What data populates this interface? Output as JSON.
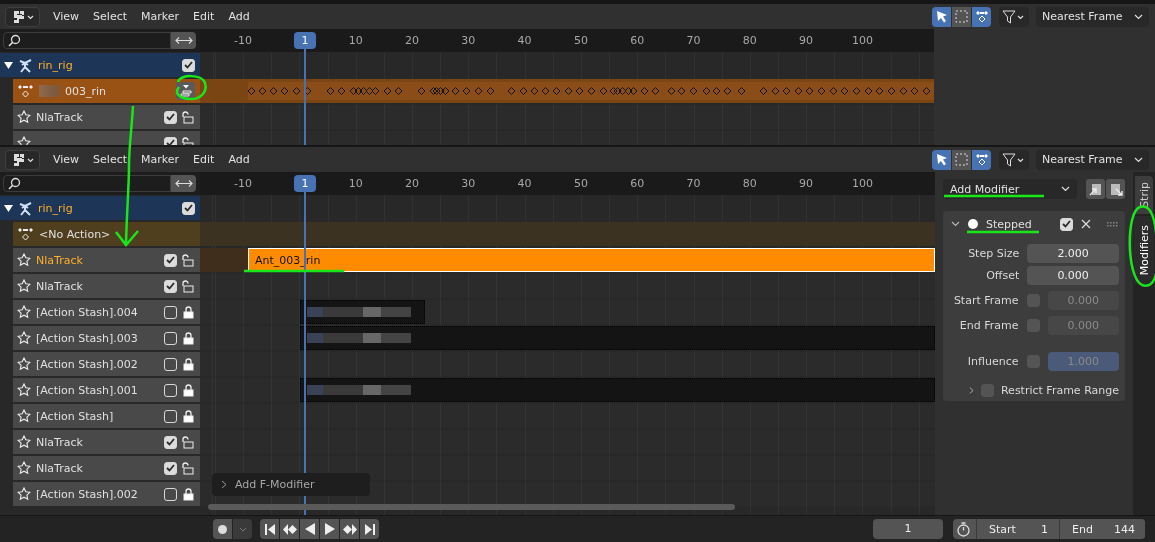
{
  "editors": [
    {
      "header": {
        "menus": [
          "View",
          "Select",
          "Marker",
          "Edit",
          "Add"
        ],
        "tools": [
          {
            "kind": "select",
            "selected": true
          },
          {
            "kind": "box",
            "selected": false
          },
          {
            "kind": "keys",
            "selected": true
          }
        ],
        "snap": "Nearest Frame"
      },
      "ruler": {
        "labels": [
          "-10",
          "10",
          "20",
          "30",
          "40",
          "50",
          "60",
          "70",
          "80",
          "90",
          "100"
        ],
        "current_frame": "1"
      },
      "object": {
        "name": "rin_rig",
        "expanded": true,
        "checked": true
      },
      "action": {
        "name": "003_rin",
        "kind": "keyframes"
      },
      "tracks": [
        {
          "name": "NlaTrack",
          "checked": true,
          "locked": false,
          "selected": false
        },
        {
          "checked": true,
          "locked": false
        }
      ]
    },
    {
      "header": {
        "menus": [
          "View",
          "Select",
          "Marker",
          "Edit",
          "Add"
        ],
        "tools": [
          {
            "kind": "select",
            "selected": true
          },
          {
            "kind": "box",
            "selected": false
          },
          {
            "kind": "keys",
            "selected": true
          }
        ],
        "snap": "Nearest Frame"
      },
      "ruler": {
        "labels": [
          "-10",
          "10",
          "20",
          "30",
          "40",
          "50",
          "60",
          "70",
          "80",
          "90",
          "100"
        ],
        "current_frame": "1"
      },
      "object": {
        "name": "rin_rig",
        "expanded": true,
        "checked": true
      },
      "action": {
        "name": "<No Action>",
        "kind": "empty"
      },
      "tracks": [
        {
          "name": "NlaTrack",
          "checked": true,
          "locked": false,
          "selected": true,
          "strip": {
            "kind": "active",
            "name": "Ant_003_rin"
          }
        },
        {
          "name": "NlaTrack",
          "checked": true,
          "locked": false,
          "selected": false
        },
        {
          "name": "[Action Stash].004",
          "checked": false,
          "locked": true,
          "selected": false,
          "strip": {
            "kind": "hidden_short"
          }
        },
        {
          "name": "[Action Stash].003",
          "checked": false,
          "locked": true,
          "selected": false,
          "strip": {
            "kind": "hidden_long"
          }
        },
        {
          "name": "[Action Stash].002",
          "checked": false,
          "locked": true,
          "selected": false
        },
        {
          "name": "[Action Stash].001",
          "checked": false,
          "locked": true,
          "selected": false,
          "strip": {
            "kind": "hidden_long"
          }
        },
        {
          "name": "[Action Stash]",
          "checked": false,
          "locked": true,
          "selected": false
        },
        {
          "name": "NlaTrack",
          "checked": true,
          "locked": false,
          "selected": false
        },
        {
          "name": "NlaTrack",
          "checked": true,
          "locked": false,
          "selected": false
        },
        {
          "name": "[Action Stash].002",
          "checked": false,
          "locked": true,
          "selected": false
        }
      ],
      "overlay_panel": {
        "label": "Add F-Modifier",
        "expanded": false
      },
      "sidebar": {
        "add_modifier": "Add Modifier",
        "tabs": [
          {
            "label": "Strip",
            "selected": false
          },
          {
            "label": "Modifiers",
            "selected": true
          }
        ],
        "modifier": {
          "name": "Stepped",
          "expanded": true,
          "enabled": true,
          "checked": true,
          "props": [
            {
              "kind": "number",
              "label": "Step Size",
              "value": "2.000"
            },
            {
              "kind": "number",
              "label": "Offset",
              "value": "0.000"
            },
            {
              "kind": "toggle_number",
              "label": "Start Frame",
              "value": "0.000",
              "checked": false,
              "disabled": true
            },
            {
              "kind": "toggle_number",
              "label": "End Frame",
              "value": "0.000",
              "checked": false,
              "disabled": true
            },
            {
              "kind": "toggle_factor",
              "label": "Influence",
              "value": "1.000",
              "checked": false,
              "disabled": true
            }
          ],
          "restrict": {
            "label": "Restrict Frame Range",
            "expanded": false,
            "checked": false
          }
        }
      }
    }
  ],
  "playback": {
    "current_frame": "1",
    "start_label": "Start",
    "start": "1",
    "end_label": "End",
    "end": "144"
  }
}
